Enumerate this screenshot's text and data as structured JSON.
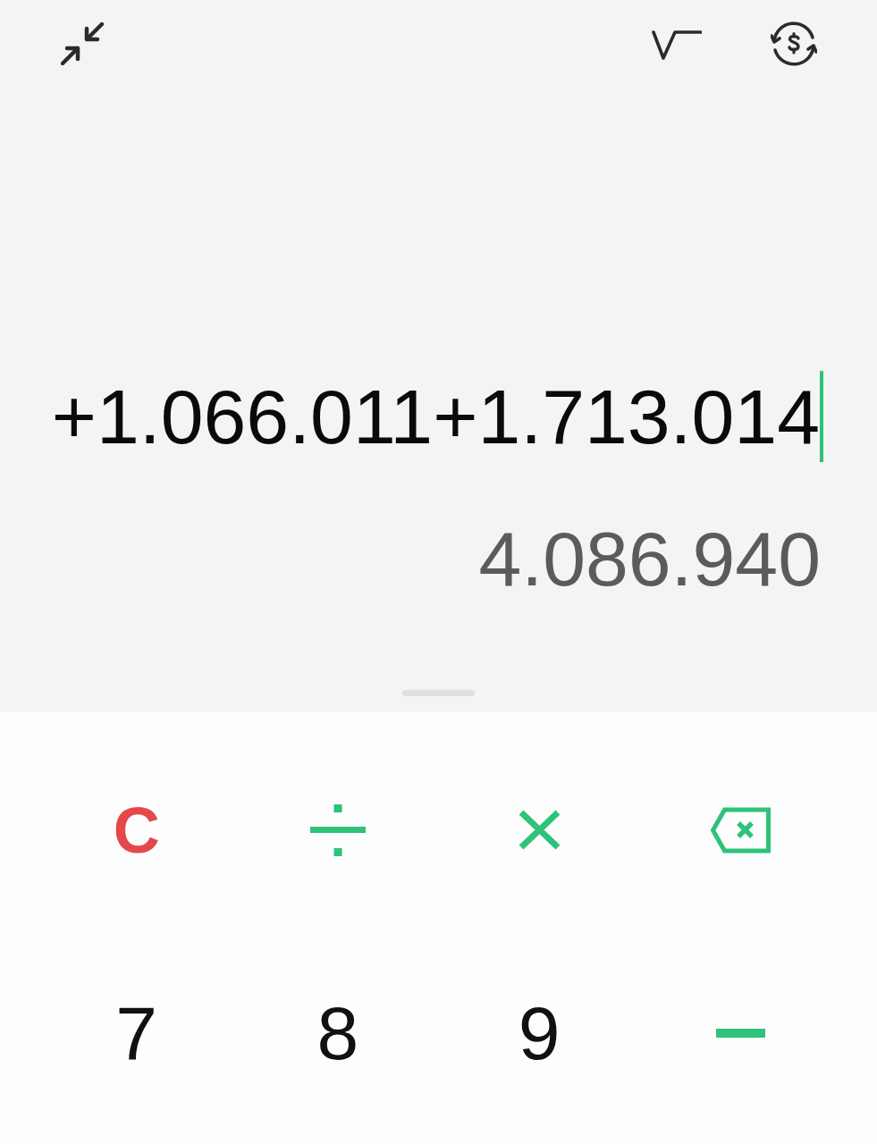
{
  "display": {
    "expression": {
      "value": "+1.066.011+1.713.014",
      "focused": true
    },
    "result": "4.086.940"
  },
  "keypad": {
    "rows": [
      [
        {
          "kind": "clear",
          "label": "C"
        },
        {
          "kind": "divide"
        },
        {
          "kind": "multiply"
        },
        {
          "kind": "backspace"
        }
      ],
      [
        {
          "kind": "digit",
          "label": "7"
        },
        {
          "kind": "digit",
          "label": "8"
        },
        {
          "kind": "digit",
          "label": "9"
        },
        {
          "kind": "subtract"
        }
      ]
    ]
  }
}
